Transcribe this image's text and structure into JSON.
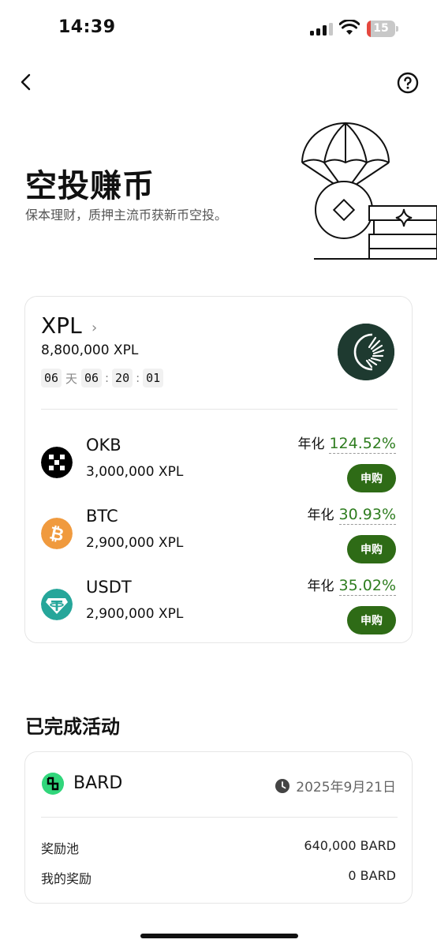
{
  "status_bar": {
    "time": "14:39",
    "battery_level": "15",
    "battery_fraction": 0.15
  },
  "hero": {
    "title": "空投赚币",
    "subtitle": "保本理财，质押主流币获新币空投。"
  },
  "project": {
    "name": "XPL",
    "total": "8,800,000 XPL",
    "countdown": {
      "days": "06",
      "day_unit": "天",
      "hours": "06",
      "minutes": "20",
      "seconds": "01",
      "separator": ":"
    },
    "apr_label": "年化",
    "subscribe_label": "申购",
    "pools": [
      {
        "coin": "OKB",
        "amount": "3,000,000 XPL",
        "apr": "124.52%"
      },
      {
        "coin": "BTC",
        "amount": "2,900,000 XPL",
        "apr": "30.93%"
      },
      {
        "coin": "USDT",
        "amount": "2,900,000 XPL",
        "apr": "35.02%"
      }
    ]
  },
  "completed": {
    "section_title": "已完成活动",
    "items": [
      {
        "name": "BARD",
        "date": "2025年9月21日",
        "reward_pool_label": "奖励池",
        "reward_pool_value": "640,000 BARD",
        "my_reward_label": "我的奖励",
        "my_reward_value": "0 BARD"
      }
    ]
  },
  "colors": {
    "accent_green": "#2e6b16",
    "apr_green": "#2e7d1f",
    "btc_orange": "#f09a3e",
    "usdt_teal": "#26a69a",
    "bard_green": "#31d67b",
    "xpl_logo_bg": "#1e3a30"
  },
  "icons": [
    "back-arrow-icon",
    "help-icon",
    "parachute-airdrop-illustration",
    "okb-icon",
    "btc-icon",
    "usdt-icon",
    "bard-icon",
    "clock-icon",
    "chevron-right-icon",
    "signal-icon",
    "wifi-icon",
    "battery-icon"
  ]
}
